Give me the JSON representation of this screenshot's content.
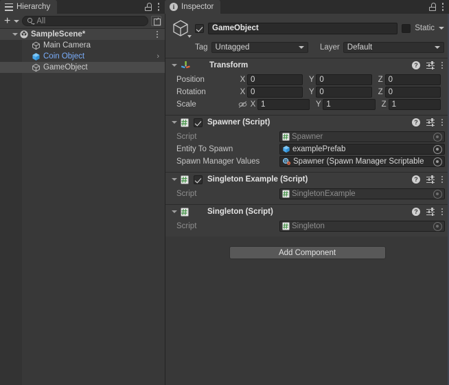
{
  "hierarchy": {
    "tab_label": "Hierarchy",
    "tab_icon": "hierarchy-icon",
    "lock_icon": "lock-open-icon",
    "menu_icon": "kebab-menu-icon",
    "toolbar": {
      "create_label": "+",
      "create_dropdown_icon": "chevron-down-icon",
      "search_placeholder": "All",
      "search_value": "",
      "search_icon": "search-icon",
      "visibility_icon": "expand-window-icon"
    },
    "rows": [
      {
        "label": "SampleScene*",
        "icon": "unity-scene-icon",
        "indent": 0,
        "kind": "scene",
        "selected": false,
        "foldout": "down",
        "kebab": true,
        "chevron": false
      },
      {
        "label": "Main Camera",
        "icon": "gameobject-cube-icon",
        "indent": 1,
        "kind": "gameobject",
        "selected": false,
        "foldout": "none",
        "kebab": false,
        "chevron": false
      },
      {
        "label": "Coin Object",
        "icon": "prefab-cube-icon",
        "indent": 1,
        "kind": "prefab",
        "selected": false,
        "foldout": "none",
        "kebab": false,
        "chevron": true
      },
      {
        "label": "GameObject",
        "icon": "gameobject-cube-icon",
        "indent": 1,
        "kind": "gameobject",
        "selected": true,
        "foldout": "none",
        "kebab": false,
        "chevron": false
      }
    ]
  },
  "inspector": {
    "tab_label": "Inspector",
    "tab_icon": "info-icon",
    "lock_icon": "lock-open-icon",
    "menu_icon": "kebab-menu-icon",
    "gameobject": {
      "icon": "gameobject-cube-icon",
      "enabled": true,
      "name": "GameObject",
      "static_label": "Static",
      "static_checked": false,
      "static_dropdown_icon": "chevron-down-icon",
      "tag_label": "Tag",
      "tag_value": "Untagged",
      "layer_label": "Layer",
      "layer_value": "Default"
    },
    "components": [
      {
        "title": "Transform",
        "icon": "transform-gizmo-icon",
        "has_checkbox": false,
        "enabled": true,
        "expanded": true,
        "help_icon": "help-icon",
        "preset_icon": "preset-settings-icon",
        "menu_icon": "kebab-menu-icon",
        "kind": "transform",
        "rows": [
          {
            "label": "Position",
            "axes": [
              "X",
              "Y",
              "Z"
            ],
            "values": [
              "0",
              "0",
              "0"
            ],
            "link_icon": false
          },
          {
            "label": "Rotation",
            "axes": [
              "X",
              "Y",
              "Z"
            ],
            "values": [
              "0",
              "0",
              "0"
            ],
            "link_icon": false
          },
          {
            "label": "Scale",
            "axes": [
              "X",
              "Y",
              "Z"
            ],
            "values": [
              "1",
              "1",
              "1"
            ],
            "link_icon": true,
            "link_icon_name": "unlinked-constraint-icon"
          }
        ]
      },
      {
        "title": "Spawner (Script)",
        "icon": "csharp-script-icon",
        "has_checkbox": true,
        "enabled": true,
        "expanded": true,
        "help_icon": "help-icon",
        "preset_icon": "preset-settings-icon",
        "menu_icon": "kebab-menu-icon",
        "kind": "script",
        "fields": [
          {
            "label": "Script",
            "value": "Spawner",
            "icon": "csharp-script-icon",
            "readonly": true
          },
          {
            "label": "Entity To Spawn",
            "value": "examplePrefab",
            "icon": "prefab-cube-icon",
            "readonly": false
          },
          {
            "label": "Spawn Manager Values",
            "value": "Spawner (Spawn Manager Scriptable",
            "icon": "scriptable-object-icon",
            "readonly": false
          }
        ]
      },
      {
        "title": "Singleton Example (Script)",
        "icon": "csharp-script-icon",
        "has_checkbox": true,
        "enabled": true,
        "expanded": true,
        "help_icon": "help-icon",
        "preset_icon": "preset-settings-icon",
        "menu_icon": "kebab-menu-icon",
        "kind": "script",
        "fields": [
          {
            "label": "Script",
            "value": "SingletonExample",
            "icon": "csharp-script-icon",
            "readonly": true
          }
        ]
      },
      {
        "title": "Singleton (Script)",
        "icon": "csharp-script-icon",
        "has_checkbox": false,
        "enabled": true,
        "expanded": true,
        "help_icon": "help-icon",
        "preset_icon": "preset-settings-icon",
        "menu_icon": "kebab-menu-icon",
        "kind": "script",
        "fields": [
          {
            "label": "Script",
            "value": "Singleton",
            "icon": "csharp-script-icon",
            "readonly": true
          }
        ]
      }
    ],
    "add_component_label": "Add Component"
  },
  "colors": {
    "panel_bg": "#383838",
    "header_bg": "#3c3c3c",
    "tabbar_bg": "#2c2c2c",
    "field_bg": "#2a2a2a",
    "selected_row": "#4a4a4a",
    "prefab_blue": "#7aaefc",
    "accent_edge": "#3e4450",
    "button_bg": "#585858"
  }
}
